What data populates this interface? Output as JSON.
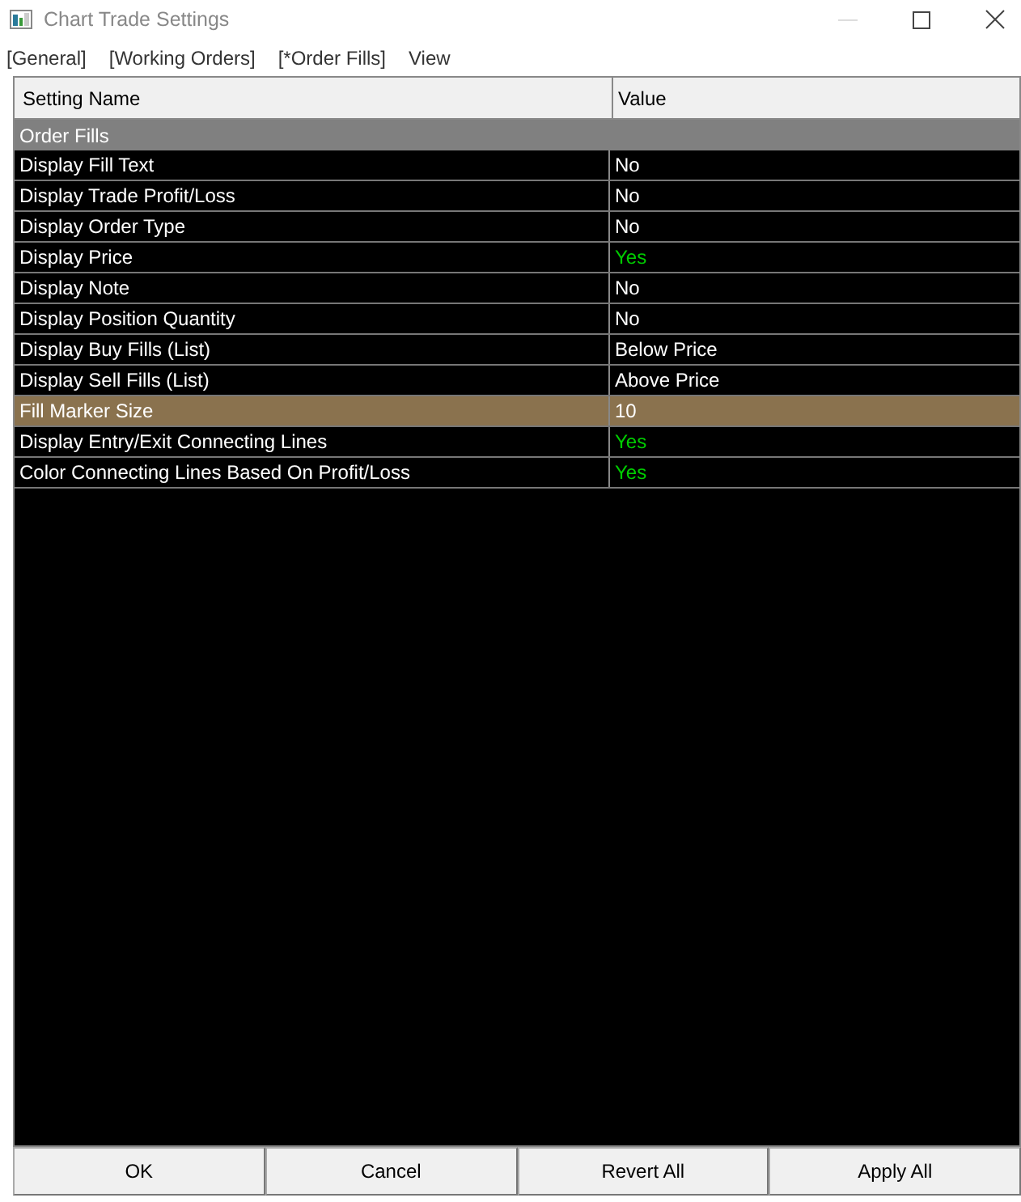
{
  "window": {
    "title": "Chart Trade Settings"
  },
  "menu": [
    "[General]",
    "[Working Orders]",
    "[*Order Fills]",
    "View"
  ],
  "table": {
    "columns": [
      "Setting Name",
      "Value"
    ],
    "group": "Order Fills",
    "rows": [
      {
        "name": "Display Fill Text",
        "value": "No",
        "on": false,
        "selected": false
      },
      {
        "name": "Display Trade Profit/Loss",
        "value": "No",
        "on": false,
        "selected": false
      },
      {
        "name": "Display Order Type",
        "value": "No",
        "on": false,
        "selected": false
      },
      {
        "name": "Display Price",
        "value": "Yes",
        "on": true,
        "selected": false
      },
      {
        "name": "Display Note",
        "value": "No",
        "on": false,
        "selected": false
      },
      {
        "name": "Display Position Quantity",
        "value": "No",
        "on": false,
        "selected": false
      },
      {
        "name": "Display Buy Fills (List)",
        "value": "Below Price",
        "selected": false
      },
      {
        "name": "Display Sell Fills (List)",
        "value": "Above Price",
        "selected": false
      },
      {
        "name": "Fill Marker Size",
        "value": "10",
        "selected": true
      },
      {
        "name": "Display Entry/Exit Connecting Lines",
        "value": "Yes",
        "on": true,
        "selected": false
      },
      {
        "name": "Color Connecting Lines Based On Profit/Loss",
        "value": "Yes",
        "on": true,
        "selected": false
      }
    ]
  },
  "buttons": [
    "OK",
    "Cancel",
    "Revert All",
    "Apply All"
  ]
}
